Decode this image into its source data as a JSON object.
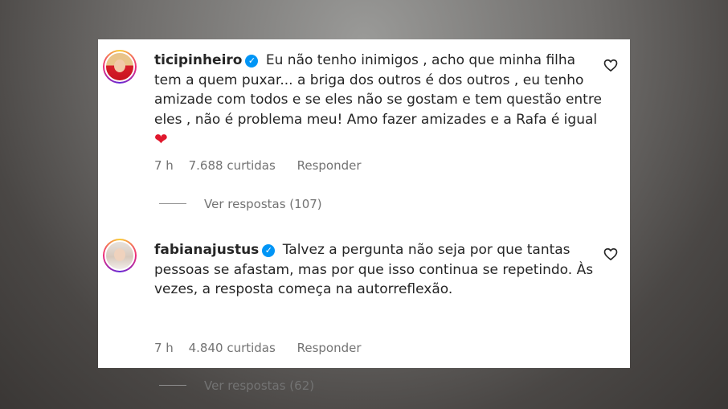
{
  "comments": [
    {
      "username": "ticipinheiro",
      "text": "Eu não tenho inimigos , acho que minha filha tem a quem puxar... a briga dos outros é dos outros , eu tenho amizade com todos e se eles não se gostam e tem questão entre eles , não é problema meu! Amo fazer amizades e a Rafa é igual",
      "emoji": "❤",
      "time": "7 h",
      "likes": "7.688 curtidas",
      "reply_label": "Responder",
      "view_replies": "Ver respostas (107)"
    },
    {
      "username": "fabianajustus",
      "text": "Talvez a pergunta não seja por que tantas pessoas se afastam, mas por que isso continua se repetindo. Às vezes, a resposta começa na autorreflexão.",
      "time": "7 h",
      "likes": "4.840 curtidas",
      "reply_label": "Responder",
      "view_replies": "Ver respostas (62)"
    }
  ],
  "icons": {
    "verified": "verified-badge-icon",
    "like": "heart-outline-icon"
  },
  "colors": {
    "verified": "#0095f6",
    "secondary_text": "#737373",
    "primary_text": "#262626"
  }
}
